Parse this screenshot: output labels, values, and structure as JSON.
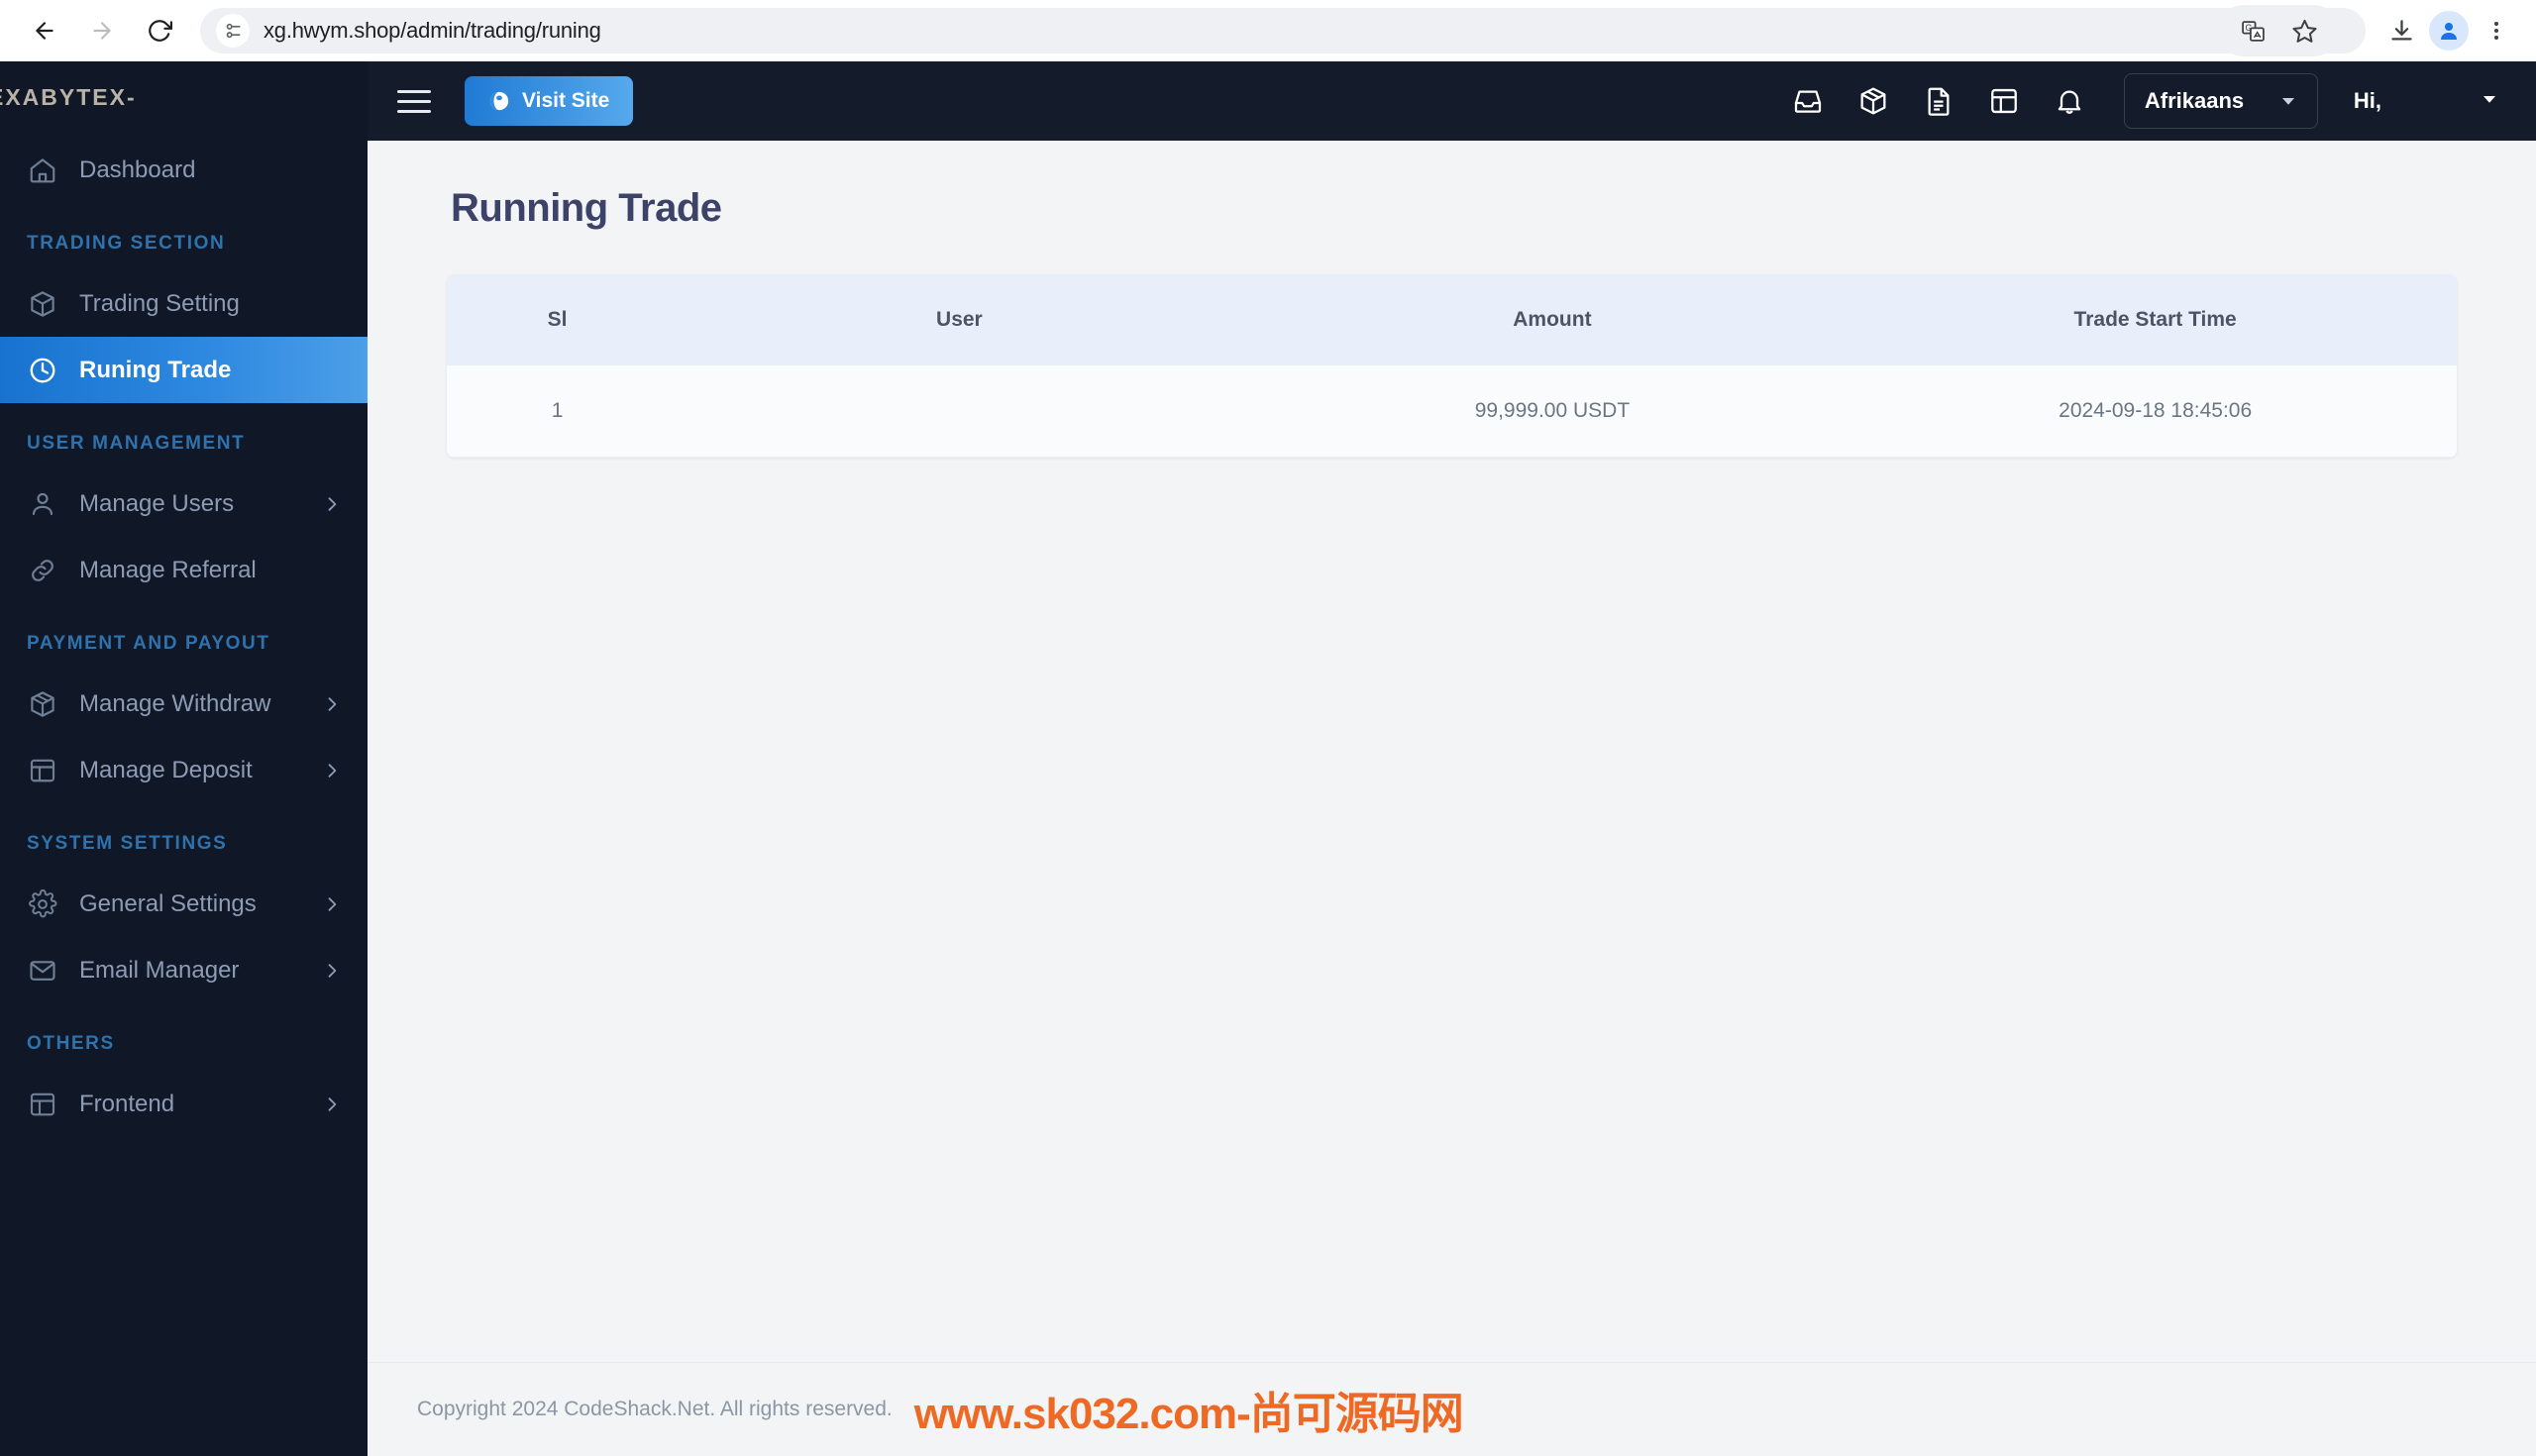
{
  "browser": {
    "url": "xg.hwym.shop/admin/trading/runing",
    "back_icon": "back-arrow-icon",
    "forward_icon": "forward-arrow-icon",
    "reload_icon": "reload-icon",
    "site_info_icon": "site-settings-icon",
    "translate_icon": "translate-icon",
    "bookmark_icon": "star-icon",
    "download_icon": "download-icon",
    "profile_icon": "profile-avatar-icon",
    "menu_icon": "three-dot-menu-icon"
  },
  "sidebar": {
    "brand": "EXABYTEX-",
    "active_item": "Runing Trade",
    "groups": [
      {
        "label": "",
        "items": [
          {
            "label": "Dashboard",
            "icon": "home-icon",
            "chevron": false,
            "active": false
          }
        ]
      },
      {
        "label": "TRADING SECTION",
        "items": [
          {
            "label": "Trading Setting",
            "icon": "box-icon",
            "chevron": false,
            "active": false
          },
          {
            "label": "Runing Trade",
            "icon": "clock-icon",
            "chevron": false,
            "active": true
          }
        ]
      },
      {
        "label": "USER MANAGEMENT",
        "items": [
          {
            "label": "Manage Users",
            "icon": "user-icon",
            "chevron": true,
            "active": false
          },
          {
            "label": "Manage Referral",
            "icon": "link-icon",
            "chevron": false,
            "active": false
          }
        ]
      },
      {
        "label": "PAYMENT AND PAYOUT",
        "items": [
          {
            "label": "Manage Withdraw",
            "icon": "box-icon",
            "chevron": true,
            "active": false
          },
          {
            "label": "Manage Deposit",
            "icon": "table-icon",
            "chevron": true,
            "active": false
          }
        ]
      },
      {
        "label": "SYSTEM SETTINGS",
        "items": [
          {
            "label": "General Settings",
            "icon": "gear-icon",
            "chevron": true,
            "active": false
          },
          {
            "label": "Email Manager",
            "icon": "envelope-icon",
            "chevron": true,
            "active": false
          }
        ]
      },
      {
        "label": "OTHERS",
        "items": [
          {
            "label": "Frontend",
            "icon": "layout-icon",
            "chevron": true,
            "active": false
          }
        ]
      }
    ]
  },
  "topbar": {
    "menu_toggle_icon": "hamburger-icon",
    "visit_site_label": "Visit Site",
    "visit_site_icon": "globe-icon",
    "icons": [
      "inbox-icon",
      "package-icon",
      "document-icon",
      "table-icon",
      "bell-icon"
    ],
    "language_selected": "Afrikaans",
    "language_caret_icon": "chevron-down-icon",
    "greeting": "Hi,",
    "greeting_caret_icon": "chevron-down-icon"
  },
  "main": {
    "page_title": "Running Trade",
    "table": {
      "columns": [
        "Sl",
        "User",
        "Amount",
        "Trade Start Time"
      ],
      "rows": [
        [
          "1",
          "",
          "99,999.00 USDT",
          "2024-09-18 18:45:06"
        ]
      ]
    }
  },
  "footer": {
    "copyright": "Copyright 2024 CodeShack.Net. All rights reserved.",
    "watermark": "www.sk032.com-尚可源码网"
  },
  "colors": {
    "sidebar_bg": "#101827",
    "topbar_bg": "#141c2b",
    "accent_blue": "#2d88e0",
    "section_label": "#2f72ad",
    "watermark_orange": "#ee6a24",
    "table_head_bg": "#e9eefb",
    "page_title": "#3c4268"
  }
}
